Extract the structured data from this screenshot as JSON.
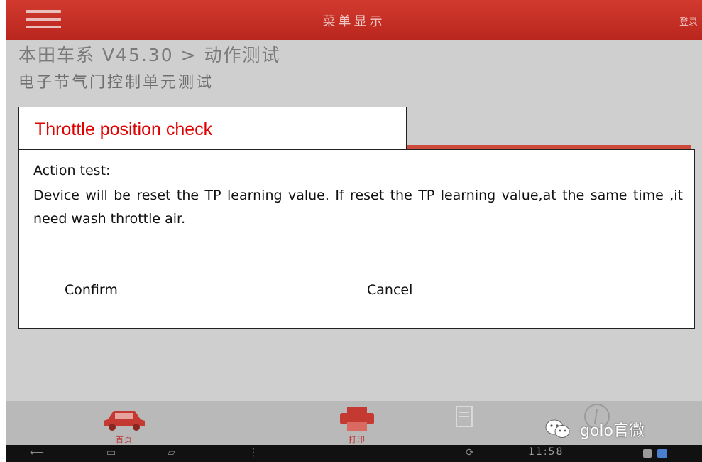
{
  "app": {
    "title": "菜单显示",
    "right_text": "登录",
    "breadcrumb": "本田车系 V45.30 > 动作测试",
    "subtitle": "电子节气门控制单元测试"
  },
  "dialog": {
    "title": "Throttle position check",
    "title_color": "#e00000",
    "action_title": "Action test:",
    "message": "Device will be reset the TP learning value. If reset the TP learning value,at the same time ,it need wash throttle air.",
    "confirm_label": "Confirm",
    "cancel_label": "Cancel"
  },
  "bottom_nav": {
    "home_label": "首页",
    "print_label": "打印"
  },
  "watermark": {
    "text": "golo官微"
  },
  "system_bar": {
    "time": "11:58"
  },
  "colors": {
    "topbar": "#c8312a",
    "background": "#cfcfcf"
  }
}
